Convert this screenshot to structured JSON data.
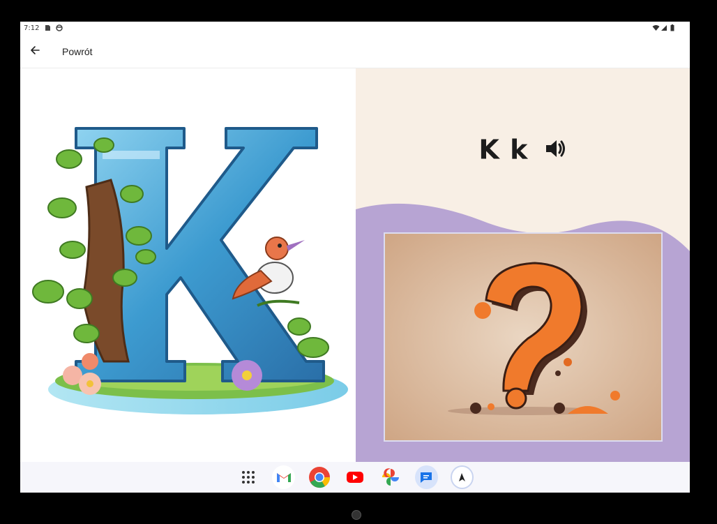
{
  "status_bar": {
    "time": "7:12",
    "left_icons": [
      "sim-card-icon",
      "circle-status-icon"
    ],
    "right_icons": [
      "wifi-icon",
      "signal-icon",
      "battery-icon"
    ]
  },
  "app_bar": {
    "back_icon": "arrow-left-icon",
    "back_label": "Powrót"
  },
  "lesson": {
    "letter": "K k",
    "speaker_icon": "speaker-icon",
    "illustration": "letter-K-with-plants-and-bird",
    "quiz_image": "question-mark"
  },
  "colors": {
    "right_panel_bg": "#f8efe5",
    "wave_purple": "#b7a4d3",
    "question_orange": "#f07a2c",
    "question_frame_bg": "#d8b598"
  },
  "dock": {
    "apps": [
      {
        "name": "app-drawer-icon"
      },
      {
        "name": "gmail-icon"
      },
      {
        "name": "chrome-icon"
      },
      {
        "name": "youtube-icon"
      },
      {
        "name": "photos-icon"
      },
      {
        "name": "messages-icon"
      },
      {
        "name": "app-icon"
      }
    ]
  }
}
